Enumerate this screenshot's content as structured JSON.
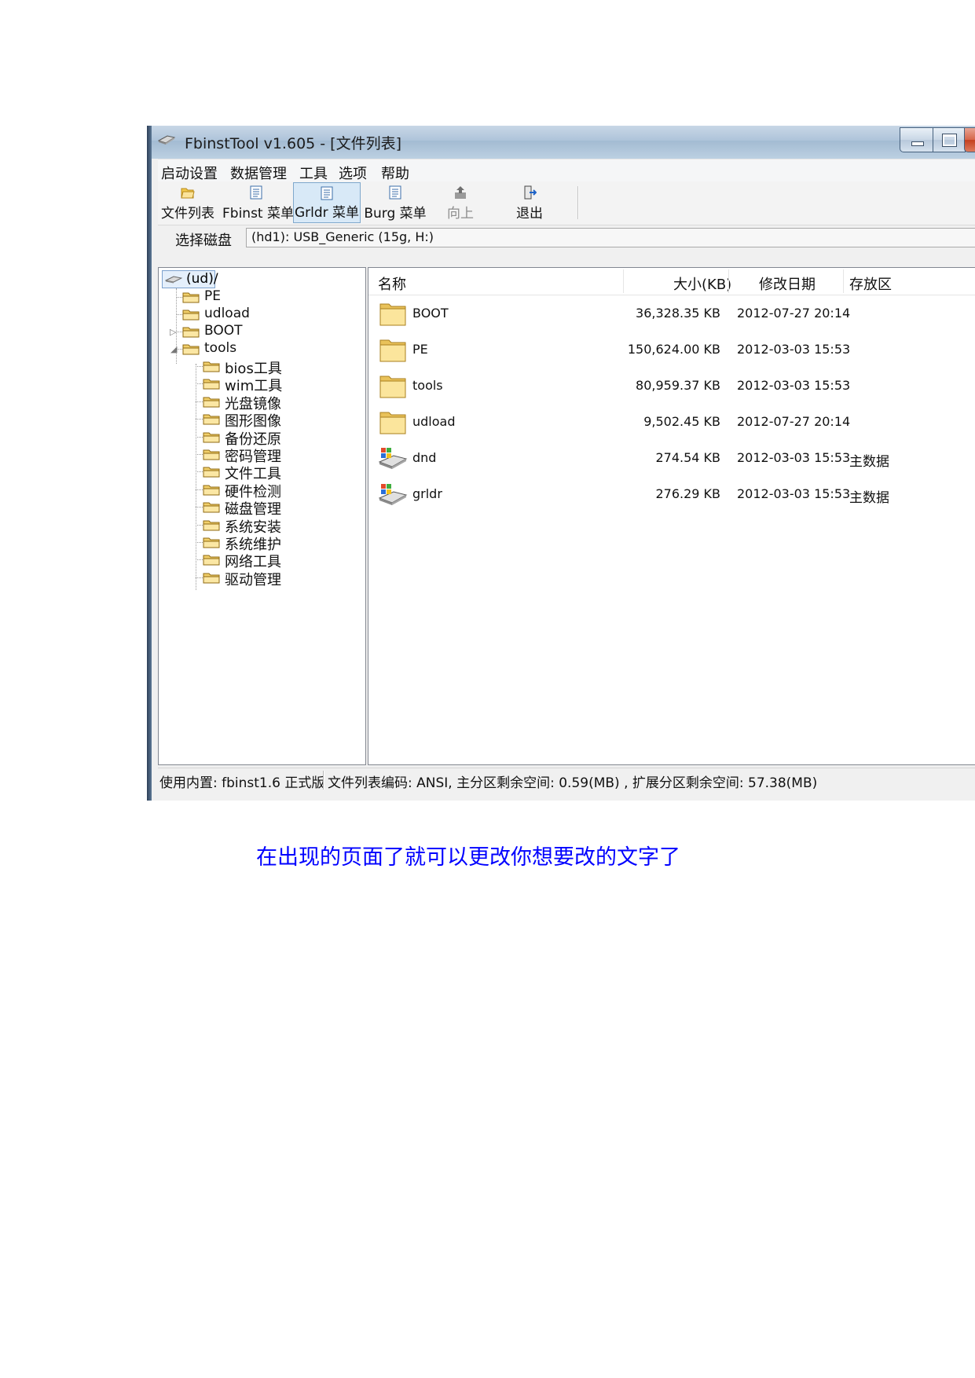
{
  "window": {
    "title": "FbinstTool v1.605 - [文件列表]"
  },
  "menu": [
    "启动设置",
    "数据管理",
    "工具",
    "选项",
    "帮助"
  ],
  "toolbar": {
    "file_list": "文件列表",
    "fbinst_menu": "Fbinst 菜单",
    "grldr_menu": "Grldr 菜单",
    "burg_menu": "Burg 菜单",
    "up": "向上",
    "exit": "退出"
  },
  "disk": {
    "label": "选择磁盘",
    "value": "(hd1): USB_Generic  (15g, H:)"
  },
  "tree": {
    "root": "(ud)/",
    "top_items": [
      "PE",
      "udload",
      "BOOT",
      "tools"
    ],
    "tools_children": [
      "bios工具",
      "wim工具",
      "光盘镜像",
      "图形图像",
      "备份还原",
      "密码管理",
      "文件工具",
      "硬件检测",
      "磁盘管理",
      "系统安装",
      "系统维护",
      "网络工具",
      "驱动管理"
    ]
  },
  "list": {
    "columns": {
      "name": "名称",
      "size": "大小(KB)",
      "date": "修改日期",
      "location": "存放区"
    },
    "rows": [
      {
        "name": "BOOT",
        "size": "36,328.35 KB",
        "date": "2012-07-27 20:14",
        "location": "",
        "icon": "folder"
      },
      {
        "name": "PE",
        "size": "150,624.00 KB",
        "date": "2012-03-03 15:53",
        "location": "",
        "icon": "folder"
      },
      {
        "name": "tools",
        "size": "80,959.37 KB",
        "date": "2012-03-03 15:53",
        "location": "",
        "icon": "folder"
      },
      {
        "name": "udload",
        "size": "9,502.45 KB",
        "date": "2012-07-27 20:14",
        "location": "",
        "icon": "folder"
      },
      {
        "name": "dnd",
        "size": "274.54 KB",
        "date": "2012-03-03 15:53",
        "location": "主数据",
        "icon": "drive"
      },
      {
        "name": "grldr",
        "size": "276.29 KB",
        "date": "2012-03-03 15:53",
        "location": "主数据",
        "icon": "drive"
      }
    ]
  },
  "status": {
    "left": "使用内置: fbinst1.6 正式版",
    "right": "文件列表编码: ANSI, 主分区剩余空间: 0.59(MB) , 扩展分区剩余空间: 57.38(MB)"
  },
  "caption": "在出现的页面了就可以更改你想要改的文字了",
  "colors": {
    "caption": "#0000ff",
    "folder": "#f5d67a",
    "selection": "#e4effb"
  }
}
